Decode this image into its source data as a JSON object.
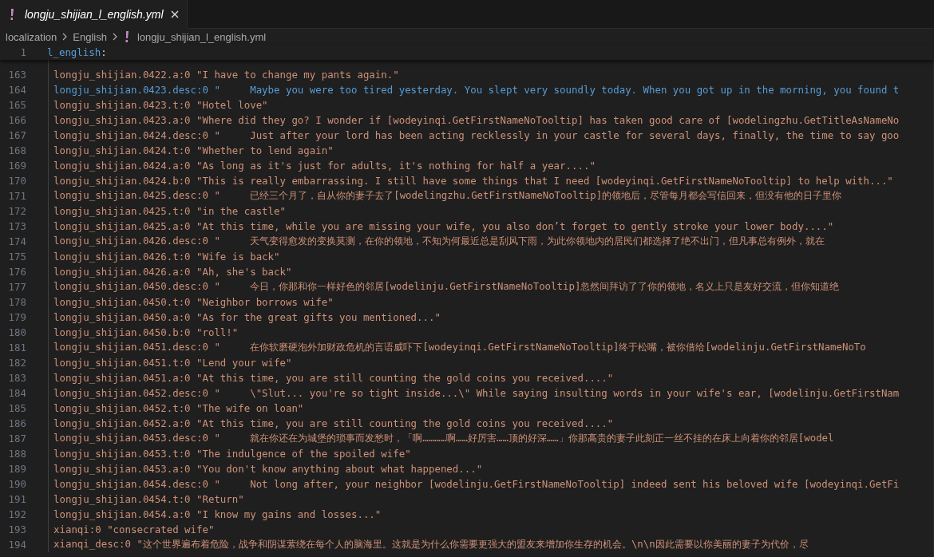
{
  "tab": {
    "label": "longju_shijian_l_english.yml",
    "selected": true
  },
  "breadcrumb": [
    "localization",
    "English",
    "longju_shijian_l_english.yml"
  ],
  "sticky_line": {
    "number": "1",
    "key": "l_english",
    "punct": ":"
  },
  "lines": [
    {
      "number": "163",
      "kind": "string",
      "text": "longju_shijian.0422.a:0 \"I have to change my pants again.\""
    },
    {
      "number": "164",
      "kind": "key",
      "text": "longju_shijian.0423.desc:0 \"     Maybe you were too tired yesterday. You slept very soundly today. When you got up in the morning, you found t"
    },
    {
      "number": "165",
      "kind": "string",
      "text": "longju_shijian.0423.t:0 \"Hotel love\""
    },
    {
      "number": "166",
      "kind": "string",
      "text": "longju_shijian.0423.a:0 \"Where did they go? I wonder if [wodeyinqi.GetFirstNameNoTooltip] has taken good care of [wodelingzhu.GetTitleAsNameNo"
    },
    {
      "number": "167",
      "kind": "string",
      "text": "longju_shijian.0424.desc:0 \"     Just after your lord has been acting recklessly in your castle for several days, finally, the time to say goo"
    },
    {
      "number": "168",
      "kind": "string",
      "text": "longju_shijian.0424.t:0 \"Whether to lend again\""
    },
    {
      "number": "169",
      "kind": "string",
      "text": "longju_shijian.0424.a:0 \"As long as it's just for adults, it's nothing for half a year....\""
    },
    {
      "number": "170",
      "kind": "string",
      "text": "longju_shijian.0424.b:0 \"This is really embarrassing. I still have some things that I need [wodeyinqi.GetFirstNameNoTooltip] to help with...\""
    },
    {
      "number": "171",
      "kind": "string",
      "text": "longju_shijian.0425.desc:0 \"     已经三个月了，自从你的妻子去了[wodelingzhu.GetFirstNameNoTooltip]的领地后，尽管每月都会写信回来，但没有他的日子里你"
    },
    {
      "number": "172",
      "kind": "string",
      "text": "longju_shijian.0425.t:0 \"in the castle\""
    },
    {
      "number": "173",
      "kind": "string",
      "text": "longju_shijian.0425.a:0 \"At this time, while you are missing your wife, you also don’t forget to gently stroke your lower body....\""
    },
    {
      "number": "174",
      "kind": "string",
      "text": "longju_shijian.0426.desc:0 \"     天气变得愈发的变换莫测，在你的领地，不知为何最近总是刮风下雨，为此你领地内的居民们都选择了绝不出门，但凡事总有例外，就在"
    },
    {
      "number": "175",
      "kind": "string",
      "text": "longju_shijian.0426.t:0 \"Wife is back\""
    },
    {
      "number": "176",
      "kind": "string",
      "text": "longju_shijian.0426.a:0 \"Ah, she's back\""
    },
    {
      "number": "177",
      "kind": "string",
      "text": "longju_shijian.0450.desc:0 \"     今日，你那和你一样好色的邻居[wodelinju.GetFirstNameNoTooltip]忽然间拜访了了你的领地，名义上只是友好交流，但你知道绝"
    },
    {
      "number": "178",
      "kind": "string",
      "text": "longju_shijian.0450.t:0 \"Neighbor borrows wife\""
    },
    {
      "number": "179",
      "kind": "string",
      "text": "longju_shijian.0450.a:0 \"As for the great gifts you mentioned...\""
    },
    {
      "number": "180",
      "kind": "string",
      "text": "longju_shijian.0450.b:0 \"roll!\""
    },
    {
      "number": "181",
      "kind": "string",
      "text": "longju_shijian.0451.desc:0 \"     在你软磨硬泡外加财政危机的言语威吓下[wodeyinqi.GetFirstNameNoTooltip]终于松嘴，被你借给[wodelinju.GetFirstNameNoTo"
    },
    {
      "number": "182",
      "kind": "string",
      "text": "longju_shijian.0451.t:0 \"Lend your wife\""
    },
    {
      "number": "183",
      "kind": "string",
      "text": "longju_shijian.0451.a:0 \"At this time, you are still counting the gold coins you received....\""
    },
    {
      "number": "184",
      "kind": "string",
      "text": "longju_shijian.0452.desc:0 \"     \\\"Slut... you're so tight inside...\\\" While saying insulting words in your wife's ear, [wodelinju.GetFirstNam"
    },
    {
      "number": "185",
      "kind": "string",
      "text": "longju_shijian.0452.t:0 \"The wife on loan\""
    },
    {
      "number": "186",
      "kind": "string",
      "text": "longju_shijian.0452.a:0 \"At this time, you are still counting the gold coins you received....\""
    },
    {
      "number": "187",
      "kind": "string",
      "text": "longju_shijian.0453.desc:0 \"     就在你还在为城堡的琐事而发愁时，「啊…………啊……好厉害……顶的好深……」你那高贵的妻子此刻正一丝不挂的在床上向着你的邻居[wodel"
    },
    {
      "number": "188",
      "kind": "string",
      "text": "longju_shijian.0453.t:0 \"The indulgence of the spoiled wife\""
    },
    {
      "number": "189",
      "kind": "string",
      "text": "longju_shijian.0453.a:0 \"You don't know anything about what happened...\""
    },
    {
      "number": "190",
      "kind": "string",
      "text": "longju_shijian.0454.desc:0 \"     Not long after, your neighbor [wodelinju.GetFirstNameNoTooltip] indeed sent his beloved wife [wodeyinqi.GetFi"
    },
    {
      "number": "191",
      "kind": "string",
      "text": "longju_shijian.0454.t:0 \"Return\""
    },
    {
      "number": "192",
      "kind": "string",
      "text": "longju_shijian.0454.a:0 \"I know my gains and losses...\""
    },
    {
      "number": "193",
      "kind": "string",
      "text": "xianqi:0 \"consecrated wife\""
    },
    {
      "number": "194",
      "kind": "string",
      "text": "xianqi_desc:0 \"这个世界遍布着危险，战争和阴谋萦绕在每个人的脑海里。这就是为什么你需要更强大的盟友来增加你生存的机会。\\n\\n因此需要以你美丽的妻子为代价，尽"
    }
  ]
}
